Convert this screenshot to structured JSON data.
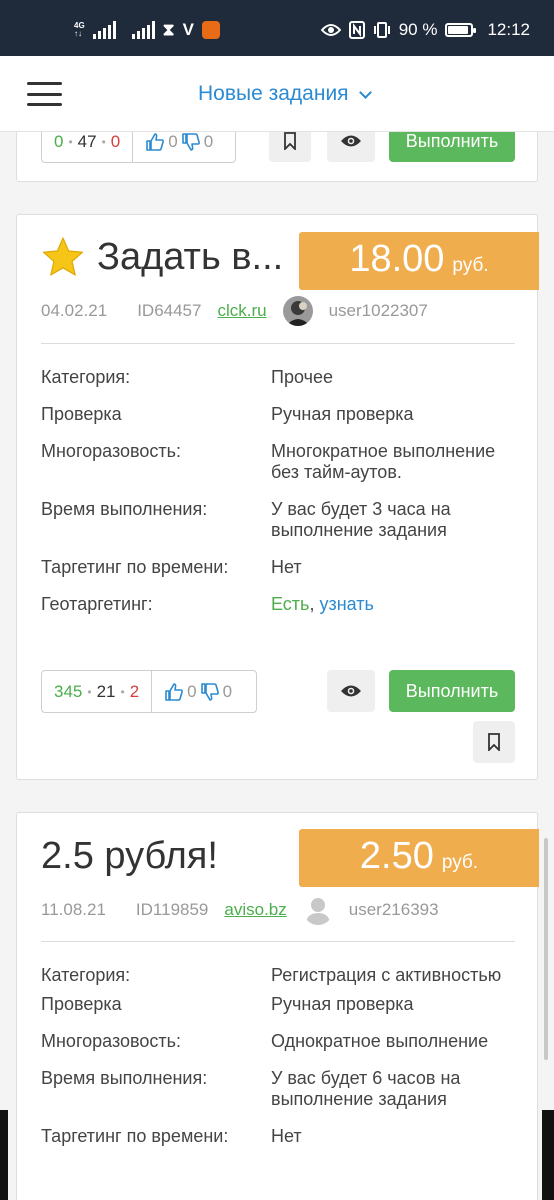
{
  "status": {
    "network": "4G",
    "battery": "90 %",
    "time": "12:12",
    "icons": [
      "signal-icon",
      "hourglass-icon",
      "v-icon",
      "app-icon",
      "eye-icon",
      "nfc-icon",
      "vibrate-icon",
      "battery-icon"
    ]
  },
  "header": {
    "title": "Новые задания",
    "menu_icon": "hamburger-icon",
    "dropdown_icon": "chevron-down-icon"
  },
  "prev_card": {
    "stats": {
      "done": "0",
      "pending": "47",
      "rejected": "0",
      "likes": "0",
      "dislikes": "0"
    },
    "button": "Выполнить"
  },
  "tasks": [
    {
      "title": "Задать в...",
      "starred": true,
      "price": "18.00",
      "currency": "руб.",
      "date": "04.02.21",
      "id": "ID64457",
      "site": "clck.ru",
      "user": "user1022307",
      "rows": [
        {
          "label": "Категория:",
          "value": "Прочее"
        },
        {
          "label": "Проверка",
          "value": "Ручная проверка"
        },
        {
          "label": "Многоразовость:",
          "value": "Многократное выполнение без тайм-аутов."
        },
        {
          "label": "Время выполнения:",
          "value": "У вас будет 3 часа на выполнение задания"
        },
        {
          "label": "Таргетинг по времени:",
          "value": "Нет"
        }
      ],
      "geo": {
        "label": "Геотаргетинг:",
        "yes": "Есть",
        "sep": ",",
        "link": "узнать"
      },
      "stats": {
        "done": "345",
        "pending": "21",
        "rejected": "2",
        "likes": "0",
        "dislikes": "0"
      },
      "button": "Выполнить"
    },
    {
      "title": "2.5 рубля!",
      "starred": false,
      "price": "2.50",
      "currency": "руб.",
      "date": "11.08.21",
      "id": "ID119859",
      "site": "aviso.bz",
      "user": "user216393",
      "rows": [
        {
          "label": "Категория:",
          "value": "Регистрация с активностью"
        },
        {
          "label": "Проверка",
          "value": "Ручная проверка"
        },
        {
          "label": "Многоразовость:",
          "value": "Однократное выполнение"
        },
        {
          "label": "Время выполнения:",
          "value": "У вас будет 6 часов на выполнение задания"
        },
        {
          "label": "Таргетинг по времени:",
          "value": "Нет"
        }
      ]
    }
  ],
  "colors": {
    "accent": "#2b8ad1",
    "success": "#5cb85c",
    "price": "#f0ad4e",
    "statusbar": "#1f2a3a"
  }
}
